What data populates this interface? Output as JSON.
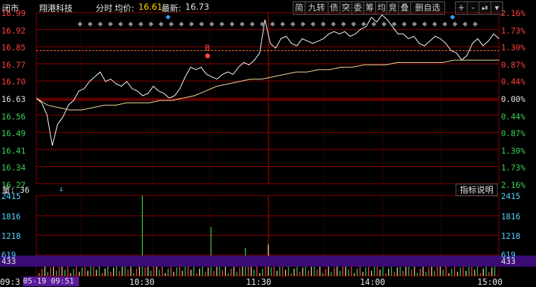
{
  "header": {
    "status": "闭市",
    "name": "翔港科技",
    "mode": "分时",
    "avg_label": "均价:",
    "avg_value": "16.61",
    "latest_label": "最新:",
    "latest_value": "16.73"
  },
  "toolbar": {
    "buttons": [
      "简",
      "九转",
      "债",
      "突",
      "委",
      "筹",
      "均",
      "竞",
      "叠",
      "删自选",
      "+",
      "-",
      "⏯",
      "▾"
    ]
  },
  "price_axis": {
    "left": [
      "16.99",
      "16.92",
      "16.85",
      "16.77",
      "16.70",
      "16.63",
      "16.56",
      "16.49",
      "16.41",
      "16.34",
      "16.27"
    ],
    "right": [
      "2.16%",
      "1.73%",
      "1.30%",
      "0.87%",
      "0.44%",
      "0.00%",
      "0.44%",
      "0.87%",
      "1.30%",
      "1.73%",
      "2.16%"
    ]
  },
  "volume_panel": {
    "label": "量: 36",
    "indicator_button": "指标说明",
    "left": [
      "2415",
      "1816",
      "1218",
      "619",
      "433"
    ],
    "right": [
      "2415",
      "1816",
      "1218",
      "619",
      "433"
    ],
    "current_bar_label": "433"
  },
  "time_axis": {
    "start": "09:3",
    "date": "05-19 09:51",
    "ticks": [
      "10:30",
      "11:30",
      "14:00",
      "15:00"
    ]
  },
  "colors": {
    "grid": "#8b0000",
    "price_line": "#ffffff",
    "avg_line": "#ffe0a0",
    "up": "#ff4040",
    "down": "#39d353",
    "highlight": "#3a0b75"
  },
  "chart_data": {
    "type": "line",
    "series": [
      {
        "values": [
          16.63,
          16.61,
          16.56,
          16.43,
          16.52,
          16.55,
          16.6,
          16.62,
          16.66,
          16.67,
          16.7,
          16.72,
          16.74,
          16.7,
          16.71,
          16.69,
          16.68,
          16.7,
          16.67,
          16.66,
          16.64,
          16.65,
          16.68,
          16.66,
          16.65,
          16.63,
          16.64,
          16.67,
          16.72,
          16.76,
          16.75,
          16.76,
          16.73,
          16.72,
          16.71,
          16.73,
          16.74,
          16.73,
          16.76,
          16.78,
          16.77,
          16.79,
          16.82,
          16.96,
          16.86,
          16.84,
          16.88,
          16.89,
          16.86,
          16.85,
          16.88,
          16.87,
          16.86,
          16.87,
          16.88,
          16.9,
          16.91,
          16.9,
          16.91,
          16.89,
          16.9,
          16.92,
          16.93,
          16.97,
          16.95,
          16.98,
          16.96,
          16.93,
          16.9,
          16.9,
          16.88,
          16.89,
          16.86,
          16.85,
          16.87,
          16.89,
          16.88,
          16.86,
          16.83,
          16.82,
          16.79,
          16.81,
          16.86,
          16.88,
          16.85,
          16.87,
          16.9,
          16.88
        ]
      },
      {
        "values": [
          16.63,
          16.6,
          16.59,
          16.58,
          16.58,
          16.59,
          16.6,
          16.6,
          16.61,
          16.61,
          16.61,
          16.62,
          16.62,
          16.63,
          16.64,
          16.66,
          16.68,
          16.69,
          16.7,
          16.71,
          16.71,
          16.72,
          16.73,
          16.74,
          16.74,
          16.75,
          16.75,
          16.76,
          16.76,
          16.77,
          16.77,
          16.77,
          16.78,
          16.78,
          16.78,
          16.78,
          16.78,
          16.79,
          16.79,
          16.79,
          16.79,
          16.79
        ]
      }
    ],
    "ylim": [
      16.27,
      16.99
    ],
    "volume": [
      2415,
      1816,
      1218,
      619,
      433
    ]
  }
}
